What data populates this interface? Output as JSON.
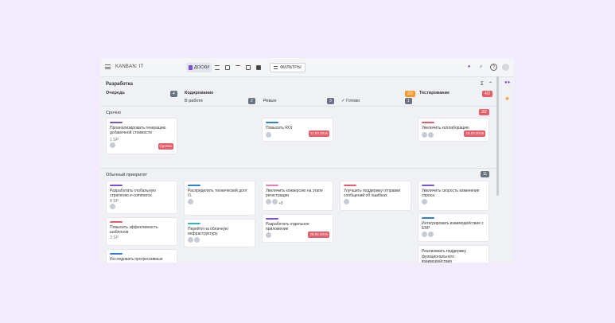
{
  "topbar": {
    "title": "KANBAN: IT",
    "views": [
      {
        "label": "ДОСКИ"
      }
    ],
    "filters": "ФИЛЬТРЫ"
  },
  "groups": [
    {
      "name": "Разработка"
    }
  ],
  "columns": [
    {
      "name": "Очередь",
      "count": "4"
    },
    {
      "name": "Кодирование",
      "sub": "В работе",
      "count": "2"
    },
    {
      "name": "",
      "sub": "Ревью",
      "count": "3"
    },
    {
      "name": "",
      "sub": "Готово",
      "count": "1",
      "limit": "2/3"
    },
    {
      "name": "Тестирование",
      "limit": "4/3"
    }
  ],
  "lanes": [
    {
      "name": "Срочно",
      "limit": "3/2"
    },
    {
      "name": "Обычный приоритет",
      "count": "11"
    }
  ],
  "cards": {
    "urgent": [
      {
        "text": "Проанализировать генерацию добавочной стоимости",
        "sp": "1 SP",
        "tag": "Срочно"
      },
      {
        "text": "Повысить ROI",
        "date": "11.03.2016"
      },
      {
        "text": "Увеличить коллаборацию",
        "date": "18.03.2016"
      }
    ],
    "normal": [
      {
        "text": "Разработать глобальную стратегию e-commerce",
        "sp": "8 SP"
      },
      {
        "text": "Повысить эффективность шаблонов",
        "sp": "3 SP"
      },
      {
        "text": "Исследовать прогрессивные"
      },
      {
        "text": "Распределить технический долг",
        "sp": "8L"
      },
      {
        "text": "Перейти на облачную инфраструктуру"
      },
      {
        "text": "Увеличить конверсию на этапе регистрации",
        "extra": "+8"
      },
      {
        "text": "Разработать отдельное приложение",
        "date": "28.02.2016"
      },
      {
        "text": "Улучшить поддержку отправки сообщений об ошибках"
      },
      {
        "text": "Увеличить скорость изменения спроса"
      },
      {
        "text": "Интегрировать взаимодействие с ERP"
      },
      {
        "text": "Реализовать поддержку функционального взаимодействия"
      }
    ]
  },
  "colors": {
    "accent": "#7b4fd8",
    "red": "#e35d6a",
    "orange": "#f29a2e",
    "bg": "#f1ebfb"
  }
}
